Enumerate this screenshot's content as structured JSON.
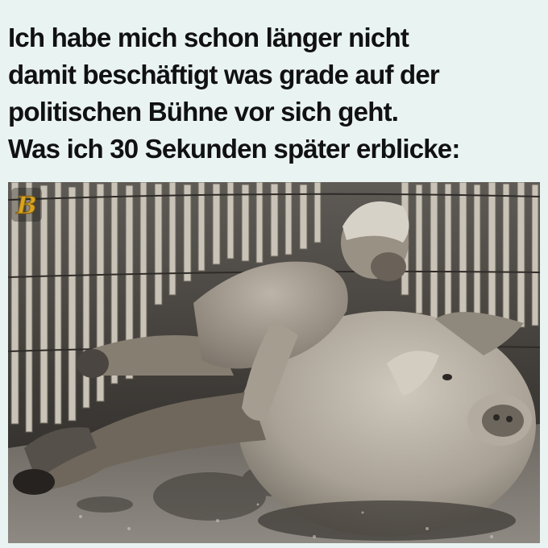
{
  "caption": {
    "lines": [
      "Ich habe mich schon länger nicht",
      "damit beschäftigt was grade auf der",
      "politischen Bühne vor sich geht.",
      "Was ich 30 Sekunden später erblicke:"
    ]
  },
  "photo": {
    "subject": "man lying on a large muddy pig in front of a wooden picket fence",
    "palette": {
      "background": "#e9f3f2",
      "mud": "#7a766e",
      "fence": "#c8c2b6",
      "pig": "#b6aea2",
      "shadow": "#2c2a27"
    }
  },
  "watermark": {
    "icon": "gold-letter-b-logo-icon",
    "color": "#d9a321"
  }
}
